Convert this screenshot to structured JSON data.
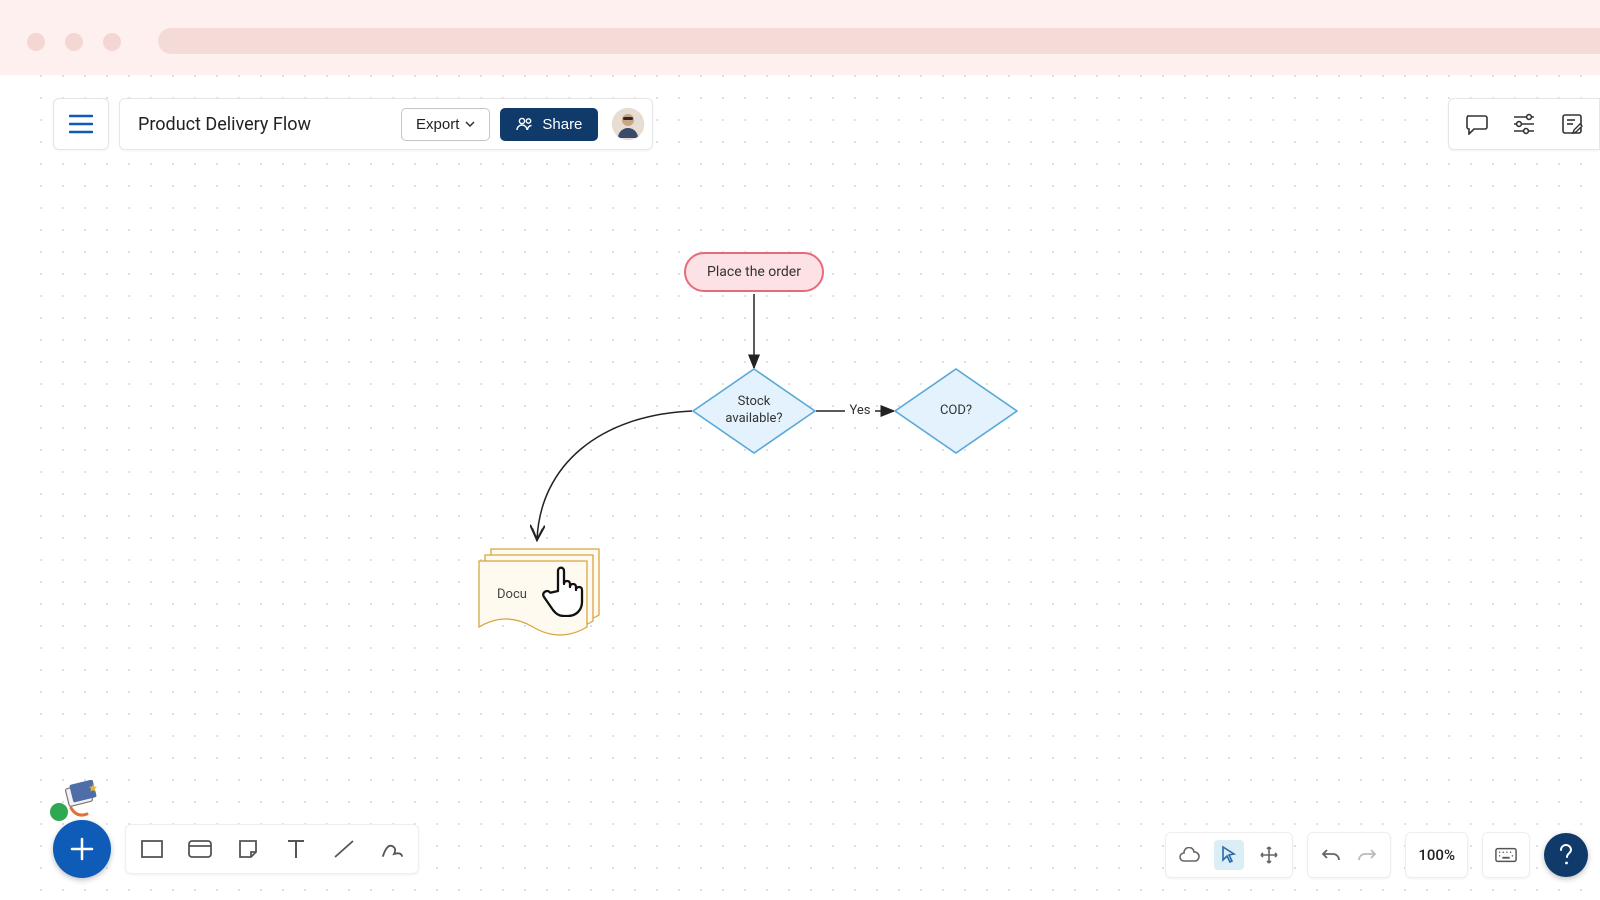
{
  "document": {
    "title": "Product Delivery Flow"
  },
  "toolbar": {
    "export_label": "Export",
    "share_label": "Share"
  },
  "zoom": {
    "level": "100%"
  },
  "flowchart": {
    "nodes": {
      "start": {
        "label": "Place the order"
      },
      "stock": {
        "label": "Stock\navailable?"
      },
      "cod": {
        "label": "COD?"
      },
      "doc": {
        "label": "Docu"
      }
    },
    "edges": {
      "stock_to_cod": {
        "label": "Yes"
      }
    }
  }
}
